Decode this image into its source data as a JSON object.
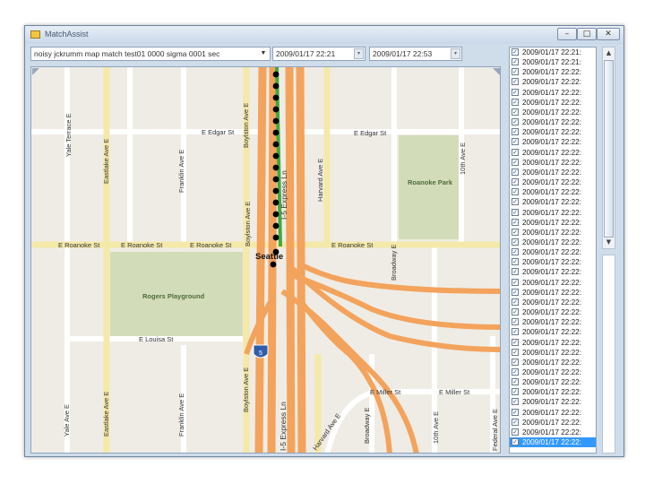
{
  "window": {
    "title": "MatchAssist",
    "buttons": {
      "minimize": "–",
      "maximize": "□",
      "close": "✕"
    }
  },
  "toolbar": {
    "trace_select": "noisy jckrumm map match test01 0000 sigma 0001 sec",
    "start_time": "2009/01/17 22:21",
    "end_time": "2009/01/17 22:53"
  },
  "map": {
    "streets": {
      "yale_terrace_e": "Yale Terrace E",
      "eastlake_ave_e_top": "Eastlake Ave E",
      "franklin_ave_e_top": "Franklin Ave E",
      "e_edgar_st_left": "E Edgar St",
      "boylston_ave_e_top": "Boylston Ave E",
      "boylston_ave_e_mid": "Boylston Ave E",
      "i5_express_top": "I-5 Express Ln",
      "harvard_ave_e_top": "Harvard Ave E",
      "e_edgar_st_right": "E Edgar St",
      "tenth_ave_e_top": "10th Ave E",
      "broadway_e_top": "Broadway E",
      "e_roanoke_st_1": "E Roanoke St",
      "e_roanoke_st_2": "E Roanoke St",
      "e_roanoke_st_3": "E Roanoke St",
      "e_roanoke_st_4": "E Roanoke St",
      "e_louisa_st": "E Louisa St",
      "yale_ave_e": "Yale Ave E",
      "eastlake_ave_e_bottom": "Eastlake Ave E",
      "franklin_ave_e_bottom": "Franklin Ave E",
      "boylston_ave_e_bottom": "Boylston Ave E",
      "i5_express_bottom": "I-5 Express Ln",
      "harvard_ave_e_bottom": "Harvard Ave E",
      "broadway_e_bottom": "Broadway E",
      "tenth_ave_e_bottom": "10th Ave E",
      "e_miller_st_left": "E Miller St",
      "e_miller_st_right": "E Miller St",
      "federal_ave_e": "Federal Ave E"
    },
    "places": {
      "roanoke_park": "Roanoke Park",
      "rogers_playground": "Rogers Playground",
      "seattle": "Seattle",
      "i5_shield": "5"
    },
    "colors": {
      "background": "#efece5",
      "street": "#ffffff",
      "arterial": "#f4e9a8",
      "highway": "#f3a35c",
      "park": "#d3dcb8",
      "route": "#3fa93f",
      "gps_point": "#000000"
    }
  },
  "list": {
    "items": [
      "2009/01/17 22:21:",
      "2009/01/17 22:21:",
      "2009/01/17 22:22:",
      "2009/01/17 22:22:",
      "2009/01/17 22:22:",
      "2009/01/17 22:22:",
      "2009/01/17 22:22:",
      "2009/01/17 22:22:",
      "2009/01/17 22:22:",
      "2009/01/17 22:22:",
      "2009/01/17 22:22:",
      "2009/01/17 22:22:",
      "2009/01/17 22:22:",
      "2009/01/17 22:22:",
      "2009/01/17 22:22:",
      "2009/01/17 22:22:",
      "2009/01/17 22:22:",
      "2009/01/17 22:22:",
      "2009/01/17 22:22:",
      "2009/01/17 22:22:",
      "2009/01/17 22:22:",
      "2009/01/17 22:22:",
      "2009/01/17 22:22:",
      "2009/01/17 22:22:",
      "2009/01/17 22:22:",
      "2009/01/17 22:22:",
      "2009/01/17 22:22:",
      "2009/01/17 22:22:",
      "2009/01/17 22:22:",
      "2009/01/17 22:22:",
      "2009/01/17 22:22:",
      "2009/01/17 22:22:",
      "2009/01/17 22:22:",
      "2009/01/17 22:22:",
      "2009/01/17 22:22:",
      "2009/01/17 22:22:",
      "2009/01/17 22:22:",
      "2009/01/17 22:22:",
      "2009/01/17 22:22:",
      "2009/01/17 22:22:"
    ],
    "checked": true,
    "selected_index": 39
  },
  "scrollbar": {
    "up": "▲",
    "down": "▼"
  }
}
